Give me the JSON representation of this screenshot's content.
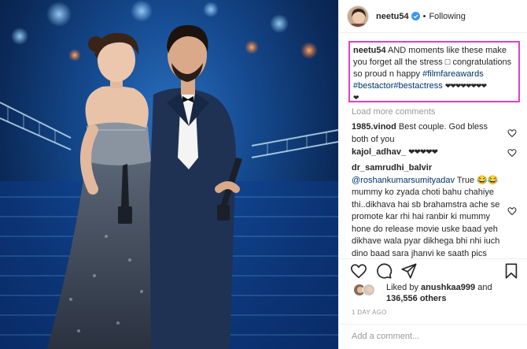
{
  "post": {
    "username": "neetu54",
    "follow_label": "Following",
    "caption": {
      "username": "neetu54",
      "text_1": "AND moments like these make you forget all the stress",
      "emoji_box": "□",
      "text_2": "congratulations so proud n happy",
      "tag_1": "#filmfareawards",
      "tag_2": "#bestactor",
      "tag_3": "#bestactress",
      "hearts_1": "❤❤❤❤❤❤❤❤",
      "hearts_2": "❤"
    },
    "load_more_label": "Load more comments",
    "comments": [
      {
        "username": "1985.vinod",
        "text": "Best couple. God bless both of you"
      },
      {
        "username": "kajol_adhav_",
        "text": "❤❤❤❤❤"
      },
      {
        "username": "dr_samrudhi_balvir",
        "mention": "@roshankumarsumityadav",
        "text": "True 😂😂 mummy ko zyada choti bahu chahiye thi..dikhava hai sb brahamstra ache se promote kar rhi hai ranbir ki mummy hone do release movie uske baad yeh dikhave wala pyar dikhega bhi nhi iuch dino baad sara jhanvi ke saath pics dalegi aunty ist to promote her son"
      }
    ],
    "likes": {
      "liked_by_prefix": "Liked by",
      "liked_by_user": "anushkaa999",
      "and_label": "and",
      "count": "136,556 others"
    },
    "time_ago": "1 DAY AGO",
    "add_comment_placeholder": "Add a comment..."
  },
  "colors": {
    "highlight_border": "#e040c8",
    "verified_blue": "#3897f0",
    "hashtag": "#003569",
    "muted": "#999999"
  },
  "icons": [
    "verified-badge-icon",
    "heart-icon",
    "comment-icon",
    "share-icon",
    "bookmark-icon",
    "more-icon"
  ]
}
